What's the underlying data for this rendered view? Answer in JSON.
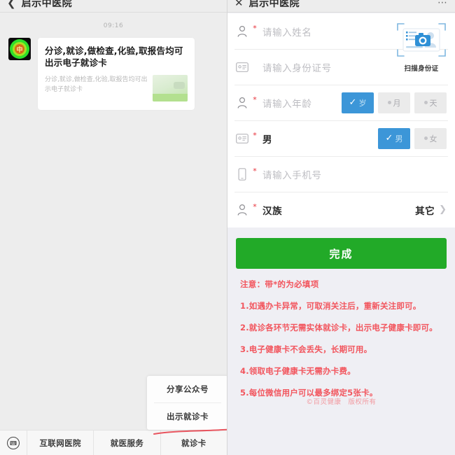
{
  "left": {
    "header": {
      "title": "启示中医院",
      "back_icon": "back-chevron-icon"
    },
    "chat": {
      "timestamp": "09:16",
      "avatar_letter": "中",
      "article": {
        "title": "分诊,就诊,做检查,化验,取报告均可出示电子就诊卡",
        "desc": "分诊,就诊,做检查,化验,取报告均可出示电子就诊卡"
      }
    },
    "popup": {
      "items": [
        {
          "label": "分享公众号"
        },
        {
          "label": "出示就诊卡"
        }
      ]
    },
    "tabbar": {
      "keyboard_icon": "keyboard-icon",
      "tabs": [
        {
          "label": "互联网医院"
        },
        {
          "label": "就医服务"
        },
        {
          "label": "就诊卡"
        }
      ]
    }
  },
  "right": {
    "header": {
      "title": "启示中医院",
      "back_icon": "close-icon",
      "more_icon": "more-dots-icon"
    },
    "scan": {
      "label": "扫描身份证",
      "icon": "scan-id-card-icon"
    },
    "form": {
      "rows": [
        {
          "icon": "person-icon",
          "required": "*",
          "text": "请输入姓名",
          "filled": false,
          "type": "input"
        },
        {
          "icon": "id-card-icon",
          "required": "",
          "text": "请输入身份证号",
          "filled": false,
          "type": "input"
        },
        {
          "icon": "person-icon",
          "required": "*",
          "text": "请输入年龄",
          "filled": false,
          "type": "segments",
          "segments": [
            {
              "label": "岁",
              "selected": true
            },
            {
              "label": "月",
              "selected": false
            },
            {
              "label": "天",
              "selected": false
            }
          ]
        },
        {
          "icon": "id-card-icon",
          "required": "*",
          "text": "男",
          "filled": true,
          "type": "segments",
          "segments": [
            {
              "label": "男",
              "selected": true
            },
            {
              "label": "女",
              "selected": false
            }
          ]
        },
        {
          "icon": "phone-icon",
          "required": "*",
          "text": "请输入手机号",
          "filled": false,
          "type": "input"
        },
        {
          "icon": "person-icon",
          "required": "*",
          "text": "汉族",
          "filled": true,
          "type": "picker",
          "value": "其它"
        }
      ]
    },
    "submit": {
      "label": "完成",
      "color": "#22aa28"
    },
    "notice": {
      "head": "注意：带*的为必填项",
      "lines": [
        "1.如遇办卡异常，可取消关注后，重新关注即可。",
        "2.就诊各环节无需实体就诊卡，出示电子健康卡即可。",
        "3.电子健康卡不会丢失，长期可用。",
        "4.领取电子健康卡无需办卡费。",
        "5.每位微信用户可以最多绑定5张卡。"
      ],
      "color": "#f2565e"
    },
    "copyright": "©百灵健康　版权所有"
  }
}
